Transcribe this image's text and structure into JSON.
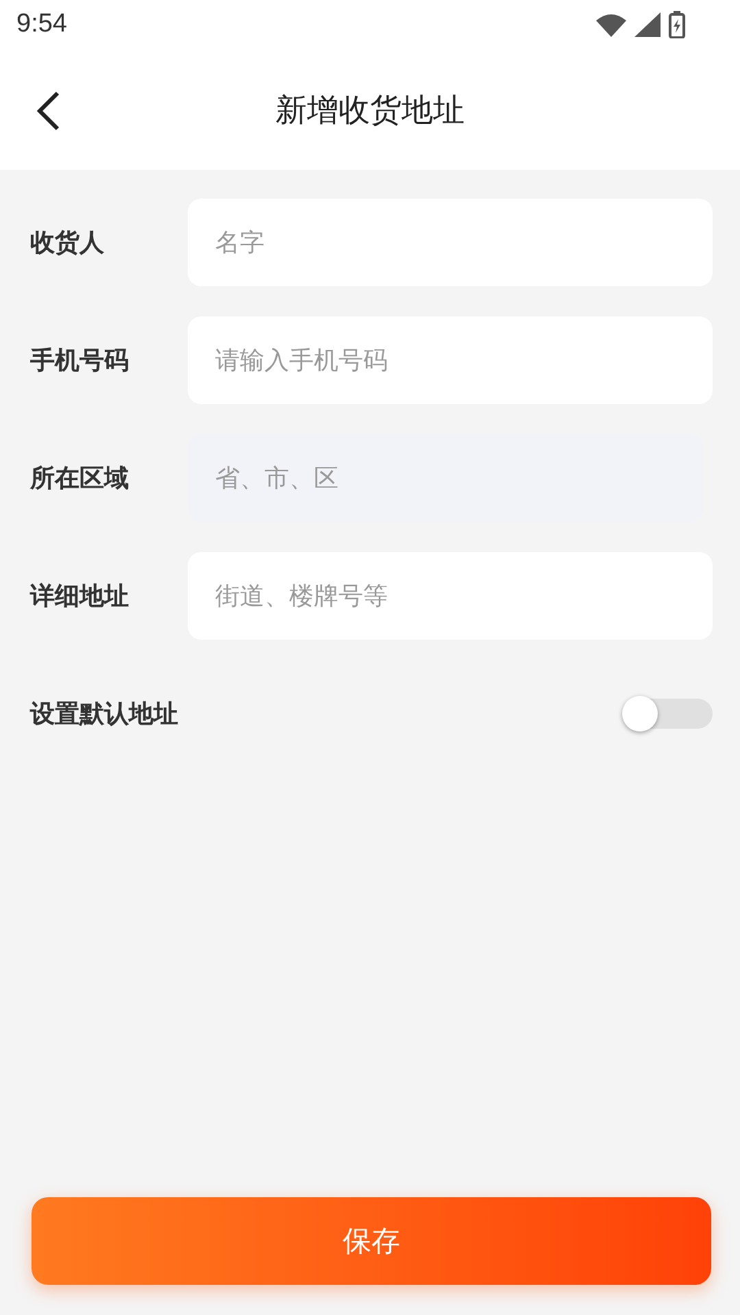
{
  "status_bar": {
    "time": "9:54"
  },
  "header": {
    "title": "新增收货地址"
  },
  "fields": [
    {
      "label": "收货人",
      "kind": "input",
      "placeholder": "名字"
    },
    {
      "label": "手机号码",
      "kind": "input",
      "placeholder": "请输入手机号码"
    },
    {
      "label": "所在区域",
      "kind": "picker",
      "placeholder": "省、市、区"
    },
    {
      "label": "详细地址",
      "kind": "input",
      "placeholder": "街道、楼牌号等"
    }
  ],
  "default_toggle": {
    "label": "设置默认地址",
    "on": false
  },
  "save_button": {
    "label": "保存"
  }
}
